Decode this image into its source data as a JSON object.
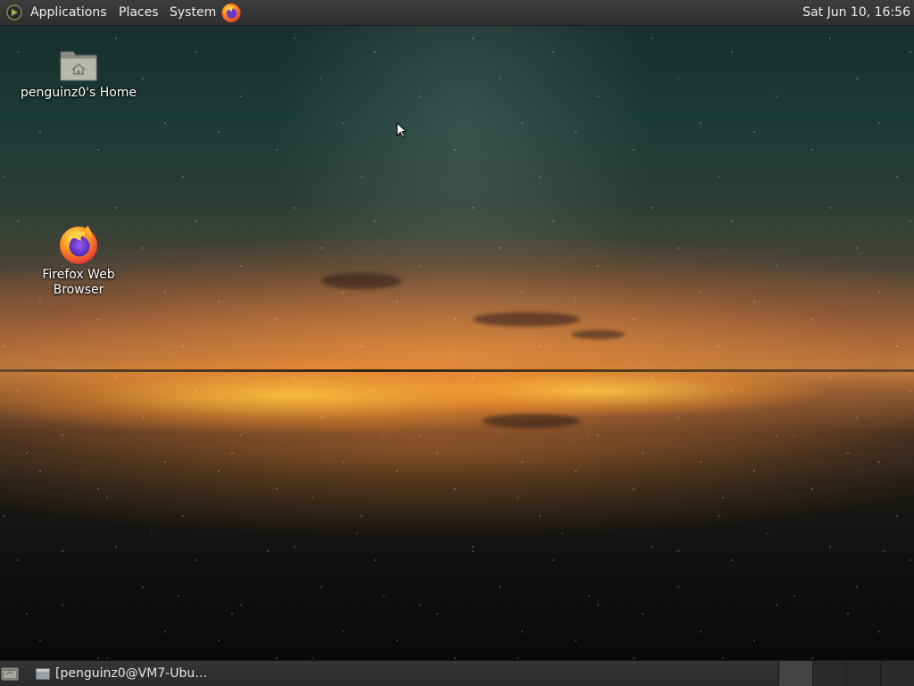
{
  "top_panel": {
    "menus": [
      "Applications",
      "Places",
      "System"
    ],
    "clock": "Sat Jun 10, 16:56",
    "launchers": [
      {
        "icon": "firefox-icon"
      }
    ],
    "menu_icon": "ubuntu-mate-logo-icon"
  },
  "desktop": {
    "icons": [
      {
        "label": "penguinz0's Home",
        "icon": "home-folder-icon"
      },
      {
        "label": "Firefox Web Browser",
        "icon": "firefox-icon"
      }
    ],
    "wallpaper": "starry sky reflected over salt flat at sunset"
  },
  "bottom_panel": {
    "show_desktop_icon": "show-desktop-icon",
    "tasks": [
      {
        "label": "[penguinz0@VM7-Ubu…",
        "icon": "terminal-window-icon"
      }
    ],
    "workspaces": 4,
    "active_workspace": 0
  },
  "colors": {
    "panel_bg": "#2f2f2f",
    "panel_text": "#eeeeee",
    "firefox_orange": "#ff7a1a",
    "firefox_purple": "#6a3cc8"
  }
}
